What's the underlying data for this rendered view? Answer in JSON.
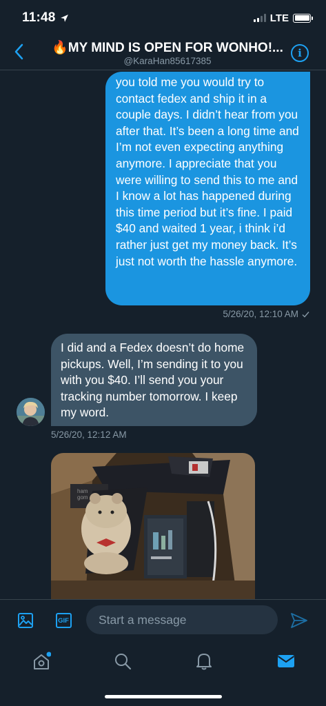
{
  "status": {
    "time": "11:48",
    "network": "LTE"
  },
  "header": {
    "title": "🔥MY MIND IS OPEN FOR WONHO!...",
    "handle": "@KaraHan85617385"
  },
  "messages": [
    {
      "direction": "sent",
      "text": "you told me you would try to contact fedex and ship it in a couple days. I didn’t hear from you after that. It’s been a long time and I’m not even expecting anything anymore. I appreciate that you were willing to send this to me and I know a lot has happened during this time period but it’s fine. I paid $40 and waited 1 year, i think i’d rather just get my money back. It’s just not worth the hassle anymore.",
      "timestamp": "5/26/20, 12:10 AM",
      "status_icon": "check-icon"
    },
    {
      "direction": "received",
      "text": "I did and a Fedex doesn’t do home pickups. Well, I’m sending it to you with you $40.  I’ll send you your tracking number tomorrow.  I keep my word.",
      "timestamp": "5/26/20, 12:12 AM"
    },
    {
      "direction": "received",
      "type": "photo",
      "photo_text": "ham gom"
    }
  ],
  "composer": {
    "placeholder": "Start a message",
    "image_icon": "image-icon",
    "gif_label": "GIF",
    "send_icon": "send-icon"
  },
  "tabs": [
    {
      "name": "home",
      "icon": "home-icon",
      "badge": true
    },
    {
      "name": "search",
      "icon": "search-icon"
    },
    {
      "name": "notifications",
      "icon": "bell-icon"
    },
    {
      "name": "messages",
      "icon": "mail-icon",
      "active": true
    }
  ],
  "colors": {
    "background": "#15202b",
    "accent": "#1da1f2",
    "sent_bubble": "#1b95e0",
    "received_bubble": "#3d5466",
    "secondary_text": "#8899a6"
  }
}
